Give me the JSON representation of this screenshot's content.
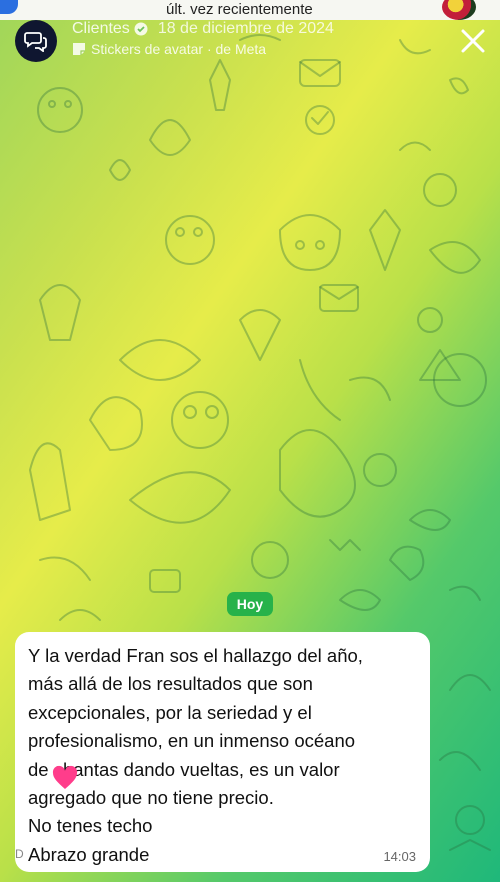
{
  "status_strip": {
    "last_seen": "últ. vez recientemente"
  },
  "header": {
    "title": "Clientes",
    "date": "18 de diciembre de 2024",
    "subtitle": "Stickers de avatar · de Meta"
  },
  "chat": {
    "date_pill": "Hoy",
    "message": {
      "lines": [
        "Y la verdad Fran sos el hallazgo del año,",
        "más allá de los resultados que son",
        "excepcionales, por la seriedad y el",
        "profesionalismo, en un inmenso océano",
        "de chantas dando vueltas, es un valor",
        "agregado que no tiene precio.",
        "No tenes techo",
        "Abrazo grande"
      ],
      "time": "14:03"
    },
    "overlay_mark": "D"
  },
  "icons": {
    "avatar": "chat-bubbles-icon",
    "verified": "verified-badge-icon",
    "sticker": "sticker-icon",
    "close": "close-icon",
    "reaction": "heart-icon"
  },
  "colors": {
    "pill": "#27b24a",
    "bubble": "#ffffff",
    "heart": "#ff3d8b"
  }
}
